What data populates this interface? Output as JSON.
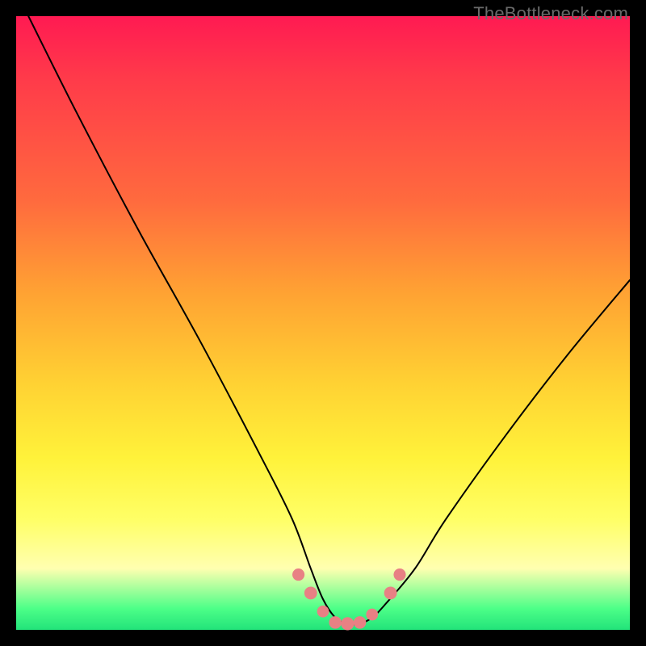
{
  "watermark": "TheBottleneck.com",
  "chart_data": {
    "type": "line",
    "title": "",
    "xlabel": "",
    "ylabel": "",
    "xlim": [
      0,
      100
    ],
    "ylim": [
      0,
      100
    ],
    "grid": false,
    "legend": false,
    "series": [
      {
        "name": "curve",
        "x": [
          2,
          10,
          20,
          30,
          40,
          45,
          48,
          50,
          52,
          54,
          56,
          58,
          60,
          65,
          70,
          80,
          90,
          100
        ],
        "y": [
          100,
          84,
          65,
          47,
          28,
          18,
          10,
          5,
          2,
          1,
          1,
          2,
          4,
          10,
          18,
          32,
          45,
          57
        ]
      }
    ],
    "markers": [
      {
        "x": 46,
        "y": 9,
        "r": 2.8
      },
      {
        "x": 48,
        "y": 6,
        "r": 3.2
      },
      {
        "x": 50,
        "y": 3,
        "r": 2.6
      },
      {
        "x": 52,
        "y": 1.2,
        "r": 3.0
      },
      {
        "x": 54,
        "y": 1.0,
        "r": 3.4
      },
      {
        "x": 56,
        "y": 1.2,
        "r": 3.0
      },
      {
        "x": 58,
        "y": 2.5,
        "r": 2.6
      },
      {
        "x": 61,
        "y": 6,
        "r": 3.2
      },
      {
        "x": 62.5,
        "y": 9,
        "r": 2.8
      }
    ],
    "gradient_meaning": "background_vertical_heat_green_bottom_red_top"
  }
}
